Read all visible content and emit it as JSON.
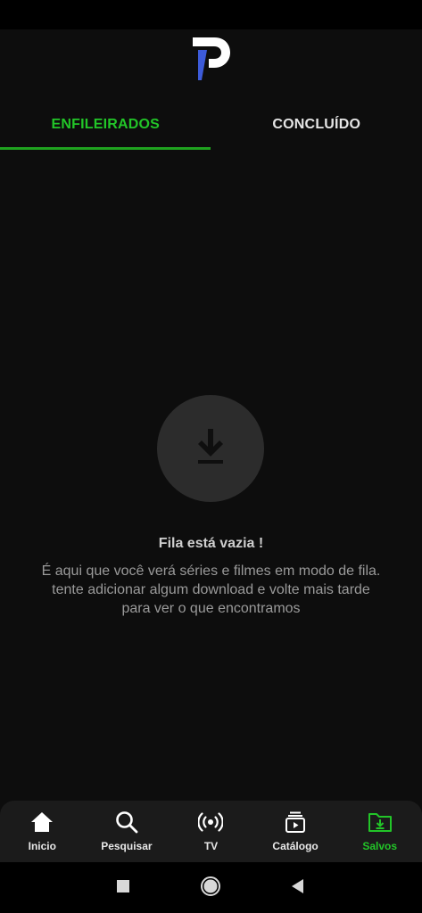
{
  "app": {
    "logo_icon": "app-logo-p",
    "accent_color": "#22c528",
    "logo_blue": "#3d5bd9"
  },
  "tabs": [
    {
      "label": "ENFILEIRADOS",
      "active": true
    },
    {
      "label": "CONCLUÍDO",
      "active": false
    }
  ],
  "empty_state": {
    "icon": "download-icon",
    "title": "Fila está vazia !",
    "description": "É aqui que você verá séries e filmes em modo de fila. tente adicionar algum download e volte mais tarde para ver o que encontramos"
  },
  "bottom_nav": [
    {
      "label": "Inicio",
      "icon": "home-icon",
      "active": false
    },
    {
      "label": "Pesquisar",
      "icon": "search-icon",
      "active": false
    },
    {
      "label": "TV",
      "icon": "broadcast-icon",
      "active": false
    },
    {
      "label": "Catálogo",
      "icon": "catalog-icon",
      "active": false
    },
    {
      "label": "Salvos",
      "icon": "saved-folder-icon",
      "active": true
    }
  ],
  "system_nav": [
    "recents-button",
    "home-button",
    "back-button"
  ]
}
